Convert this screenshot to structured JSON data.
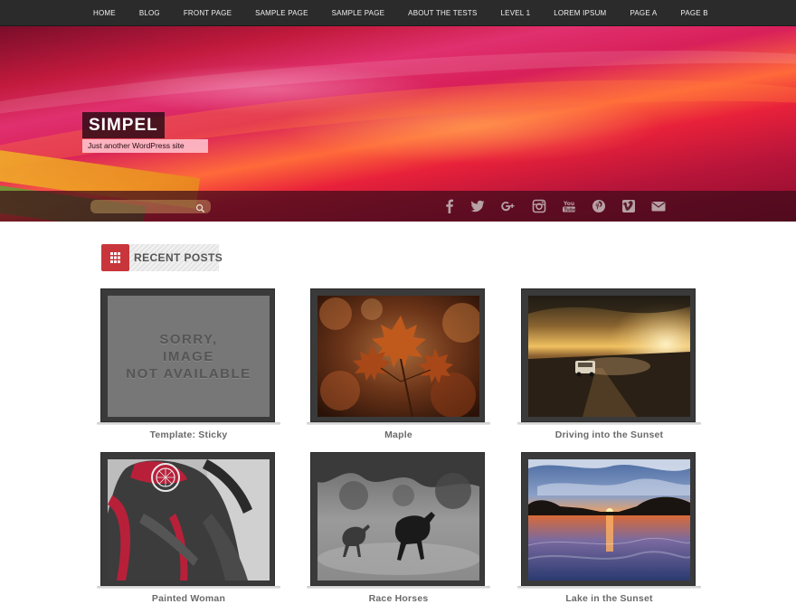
{
  "nav": {
    "items": [
      "HOME",
      "BLOG",
      "FRONT PAGE",
      "SAMPLE PAGE",
      "SAMPLE PAGE",
      "ABOUT THE TESTS",
      "LEVEL 1",
      "LOREM IPSUM",
      "PAGE A",
      "PAGE B"
    ]
  },
  "site": {
    "title": "SIMPEL",
    "description": "Just another WordPress site"
  },
  "search": {
    "placeholder": ""
  },
  "social": [
    "facebook-icon",
    "twitter-icon",
    "google-plus-icon",
    "instagram-icon",
    "youtube-icon",
    "pinterest-icon",
    "vimeo-icon",
    "email-icon"
  ],
  "recent_posts": {
    "heading": "RECENT POSTS",
    "unavailable": [
      "SORRY,",
      "IMAGE",
      "NOT AVAILABLE"
    ],
    "posts": [
      {
        "title": "Template: Sticky",
        "image": "sorry-image-not-available"
      },
      {
        "title": "Maple",
        "image": "autumn-maple-leaves"
      },
      {
        "title": "Driving into the Sunset",
        "image": "car-on-dusty-road-at-sunset"
      },
      {
        "title": "Painted Woman",
        "image": "woman-with-body-paint"
      },
      {
        "title": "Race Horses",
        "image": "horses-running-in-mist"
      },
      {
        "title": "Lake in the Sunset",
        "image": "lake-at-sunset"
      }
    ]
  },
  "colors": {
    "nav_bg": "#2b2b2b",
    "accent": "#c8363b",
    "title_bg": "#280a14",
    "desc_bg": "#ffc8d2",
    "post_frame": "#3a3a3a",
    "post_title": "#6a6a6a"
  }
}
